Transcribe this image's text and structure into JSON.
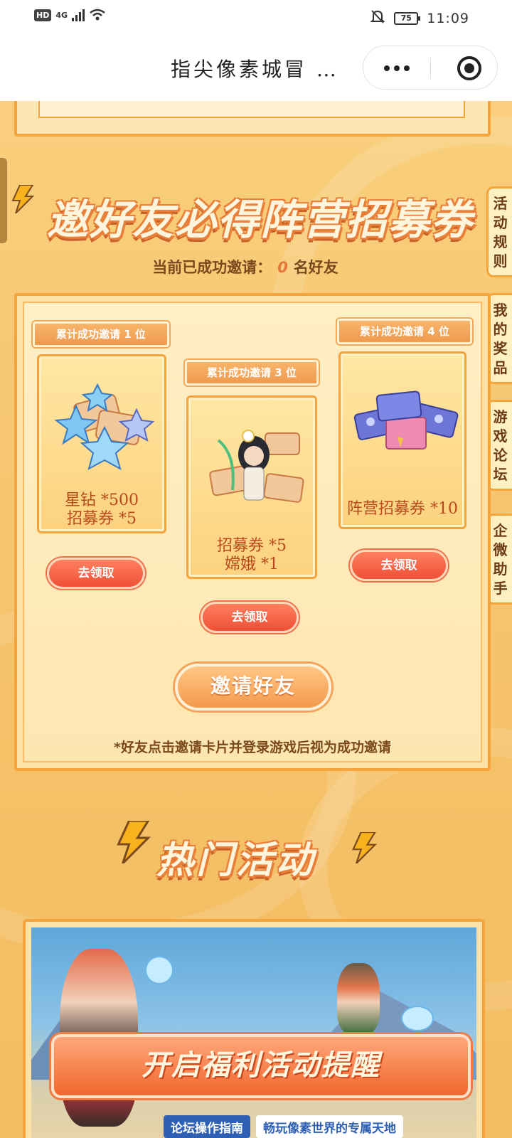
{
  "status_bar": {
    "hd": "HD",
    "network": "4G",
    "battery": "75",
    "time": "11:09"
  },
  "nav": {
    "title": "指尖像素城冒 …"
  },
  "invite": {
    "title": "邀好友必得阵营招募券",
    "status_prefix": "当前已成功邀请：",
    "count": "0",
    "status_suffix": "名好友",
    "tiers": [
      {
        "badge": "累计成功邀请 1 位",
        "line1": "星钻 *500",
        "line2": "招募券 *5",
        "claim": "去领取"
      },
      {
        "badge": "累计成功邀请 3 位",
        "line1": "招募券 *5",
        "line2": "嫦娥 *1",
        "claim": "去领取"
      },
      {
        "badge": "累计成功邀请 4 位",
        "line1": "阵营招募券 *10",
        "line2": "",
        "claim": "去领取"
      }
    ],
    "invite_button": "邀请好友",
    "note": "*好友点击邀请卡片并登录游戏后视为成功邀请"
  },
  "side_tabs": [
    "活动规则",
    "我的奖品",
    "游戏论坛",
    "企微助手"
  ],
  "hot": {
    "title": "热门活动",
    "banner_sub_a": "论坛操作指南",
    "banner_sub_b": "畅玩像素世界的专属天地",
    "remind_button": "开启福利活动提醒"
  },
  "colors": {
    "background": "#f6c56e",
    "frame": "#f5a43b",
    "claim_button": "#ef4f36",
    "reward_text": "#b8491e"
  }
}
